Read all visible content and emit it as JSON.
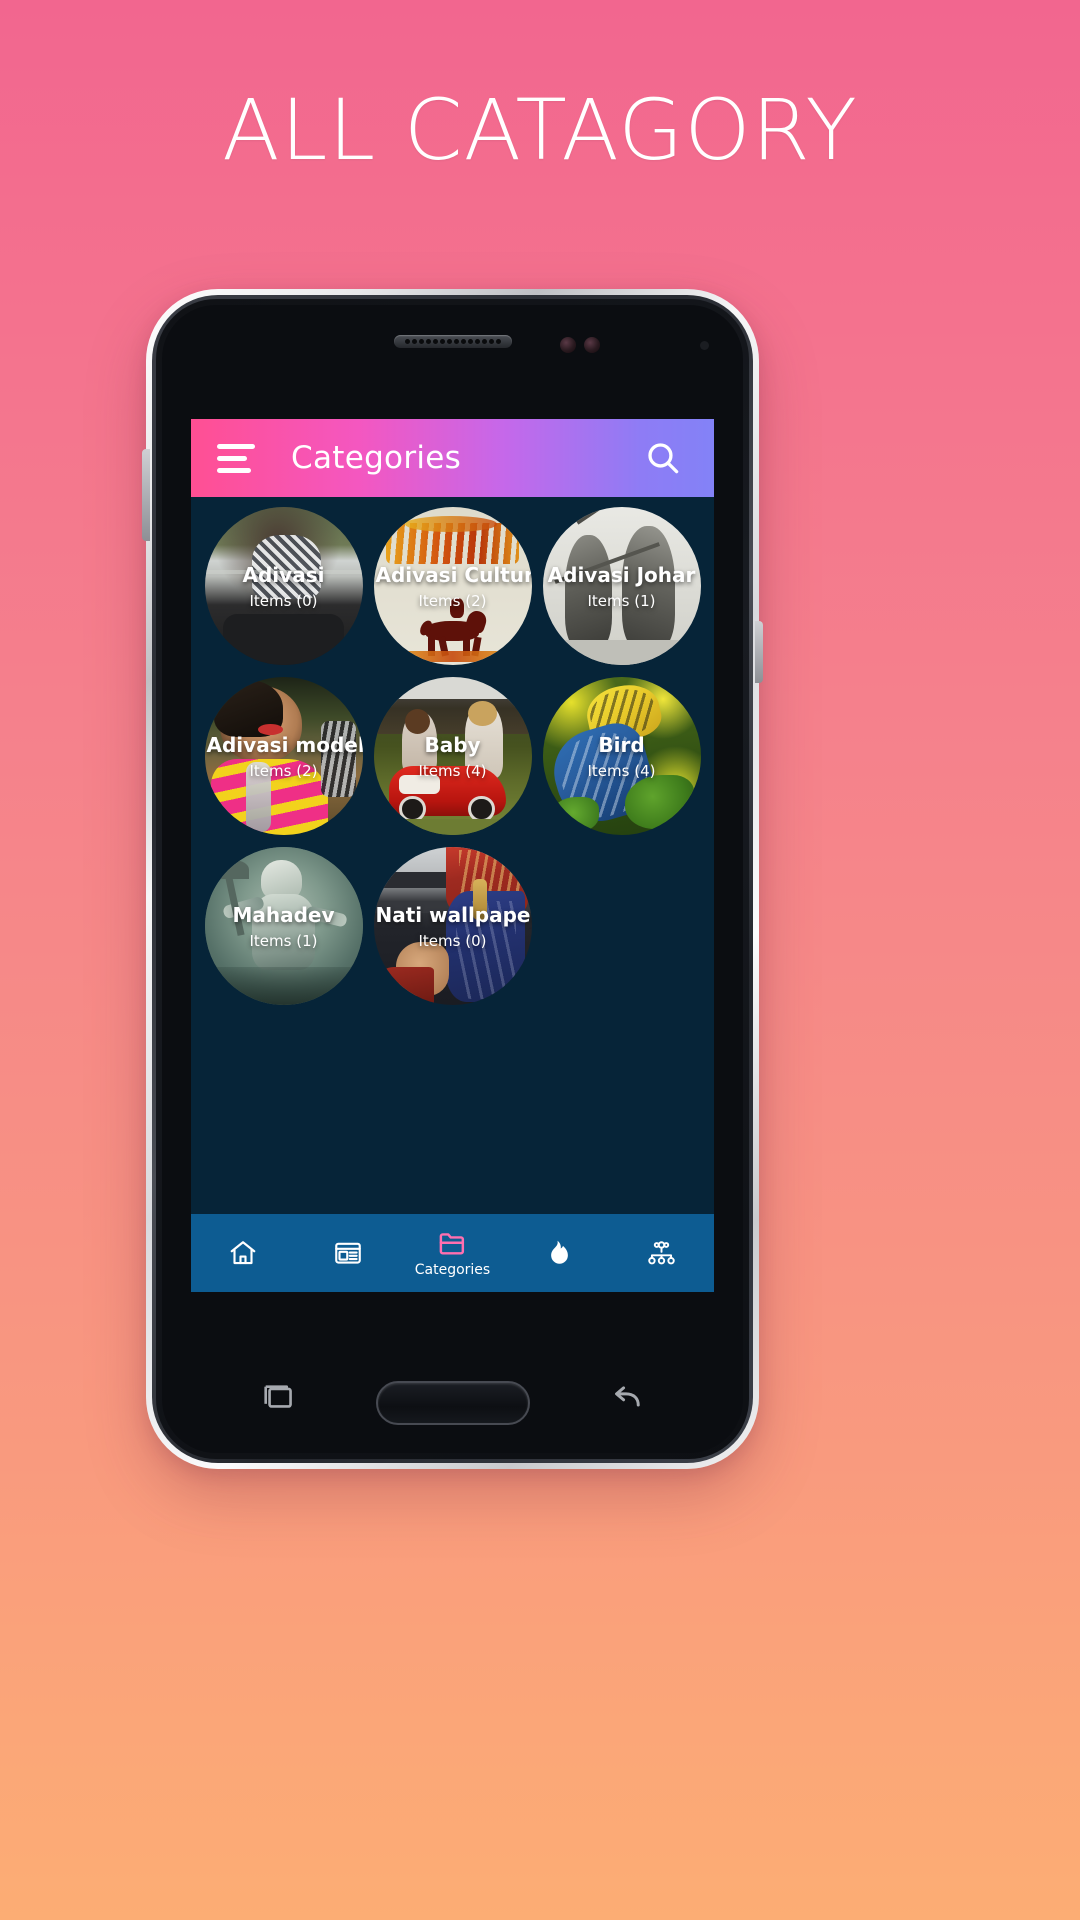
{
  "promo": {
    "headline": "ALL CATAGORY",
    "background_gradient_from": "#f2668f",
    "background_gradient_to": "#fcad74"
  },
  "device": {
    "frame": "android-phone-mockup",
    "bezel_color": "#0b0d11",
    "screen_background": "#062438"
  },
  "app": {
    "appbar": {
      "title": "Categories",
      "menu_icon": "hamburger-menu-icon",
      "search_icon": "search-icon",
      "gradient_from": "#ff4f93",
      "gradient_to": "#8382f7",
      "title_color": "#ffffff"
    },
    "categories": [
      {
        "name": "Adivasi",
        "items_label": "Items (0)",
        "count": 0,
        "art": "man-checked-shirt-sitting"
      },
      {
        "name": "Adivasi Culture",
        "items_label": "Items (2)",
        "count": 2,
        "art": "hindi-banner-horse-rider"
      },
      {
        "name": "Adivasi Johar",
        "items_label": "Items (1)",
        "count": 1,
        "art": "grayscale-archers-sketch"
      },
      {
        "name": "Adivasi model",
        "items_label": "Items (2)",
        "count": 2,
        "art": "woman-traditional-jewellery"
      },
      {
        "name": "Baby",
        "items_label": "Items (4)",
        "count": 4,
        "art": "two-toddlers-red-pedal-car"
      },
      {
        "name": "Bird",
        "items_label": "Items (4)",
        "count": 4,
        "art": "yellow-blue-parrot-foliage"
      },
      {
        "name": "Mahadev",
        "items_label": "Items (1)",
        "count": 1,
        "art": "teal-shiva-statue"
      },
      {
        "name": "Nati wallpaper",
        "items_label": "Items (0)",
        "count": 0,
        "art": "woman-blue-saree"
      }
    ],
    "bottom_nav": {
      "background": "#0d5c92",
      "active_color": "#ff6fb0",
      "items": [
        {
          "icon": "home-icon",
          "label": "",
          "active": false
        },
        {
          "icon": "news-icon",
          "label": "",
          "active": false
        },
        {
          "icon": "folder-icon",
          "label": "Categories",
          "active": true
        },
        {
          "icon": "flame-icon",
          "label": "",
          "active": false
        },
        {
          "icon": "network-icon",
          "label": "",
          "active": false
        }
      ]
    }
  },
  "system_nav": {
    "recent_icon": "recent-apps-icon",
    "home_icon": "home-key",
    "back_icon": "back-icon"
  }
}
